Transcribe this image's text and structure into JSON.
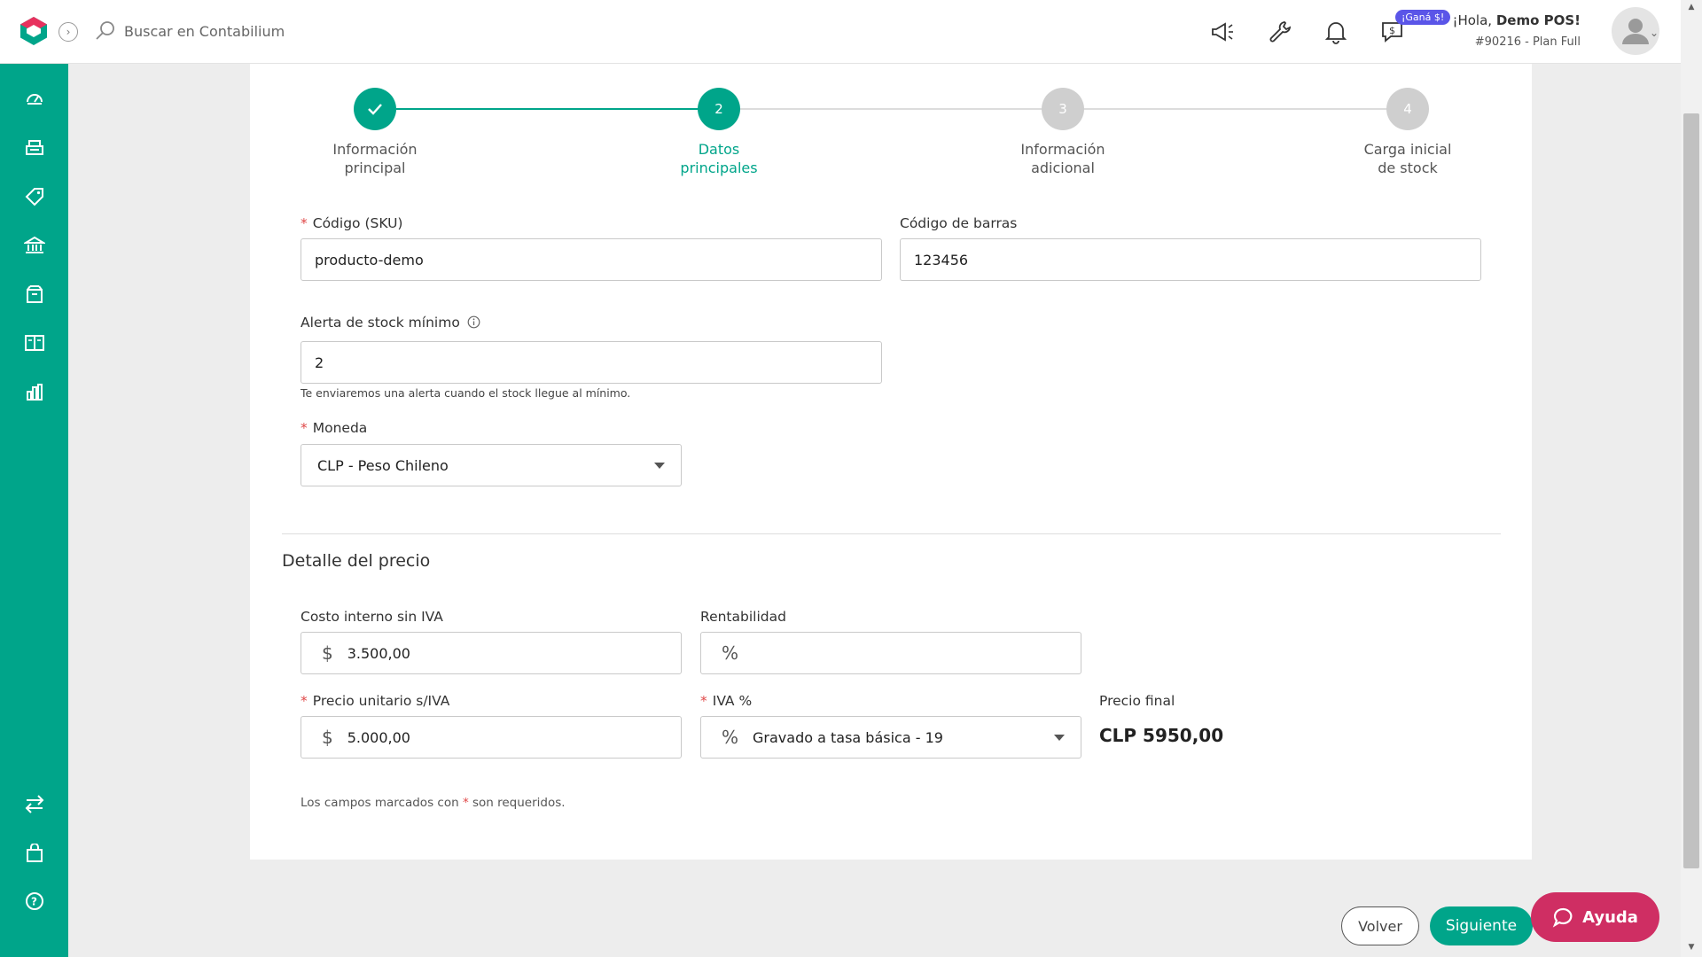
{
  "header": {
    "search_placeholder": "Buscar en Contabilium",
    "gana_badge": "¡Ganá $!",
    "greeting_prefix": "¡Hola, ",
    "user_name": "Demo POS!",
    "account_info": "#90216 - Plan Full"
  },
  "stepper": {
    "steps": [
      {
        "number": "",
        "label_line1": "Información",
        "label_line2": "principal",
        "state": "done"
      },
      {
        "number": "2",
        "label_line1": "Datos",
        "label_line2": "principales",
        "state": "active"
      },
      {
        "number": "3",
        "label_line1": "Información",
        "label_line2": "adicional",
        "state": "pending"
      },
      {
        "number": "4",
        "label_line1": "Carga inicial",
        "label_line2": "de stock",
        "state": "pending"
      }
    ]
  },
  "form": {
    "sku_label": "Código (SKU)",
    "sku_value": "producto-demo",
    "barcode_label": "Código de barras",
    "barcode_value": "123456",
    "stock_alert_label": "Alerta de stock mínimo",
    "stock_alert_value": "2",
    "stock_alert_help": "Te enviaremos una alerta cuando el stock llegue al mínimo.",
    "currency_label": "Moneda",
    "currency_value": "CLP - Peso Chileno"
  },
  "price": {
    "section_title": "Detalle del precio",
    "cost_label": "Costo interno sin IVA",
    "cost_prefix": "$",
    "cost_value": "3.500,00",
    "profit_label": "Rentabilidad",
    "profit_prefix": "%",
    "profit_value": "",
    "unit_price_label": "Precio unitario s/IVA",
    "unit_price_prefix": "$",
    "unit_price_value": "5.000,00",
    "iva_label": "IVA %",
    "iva_prefix": "%",
    "iva_value": "Gravado a tasa básica - 19",
    "final_price_label": "Precio final",
    "final_price_value": "CLP 5950,00"
  },
  "footer": {
    "note_prefix": "Los campos marcados con",
    "note_star": "*",
    "note_suffix": "son requeridos.",
    "back_button": "Volver",
    "next_button": "Siguiente",
    "help_button": "Ayuda"
  },
  "theme": {
    "primary": "#00a58a",
    "help": "#cf2e63",
    "badge": "#5a55e8",
    "required": "#e04848"
  }
}
